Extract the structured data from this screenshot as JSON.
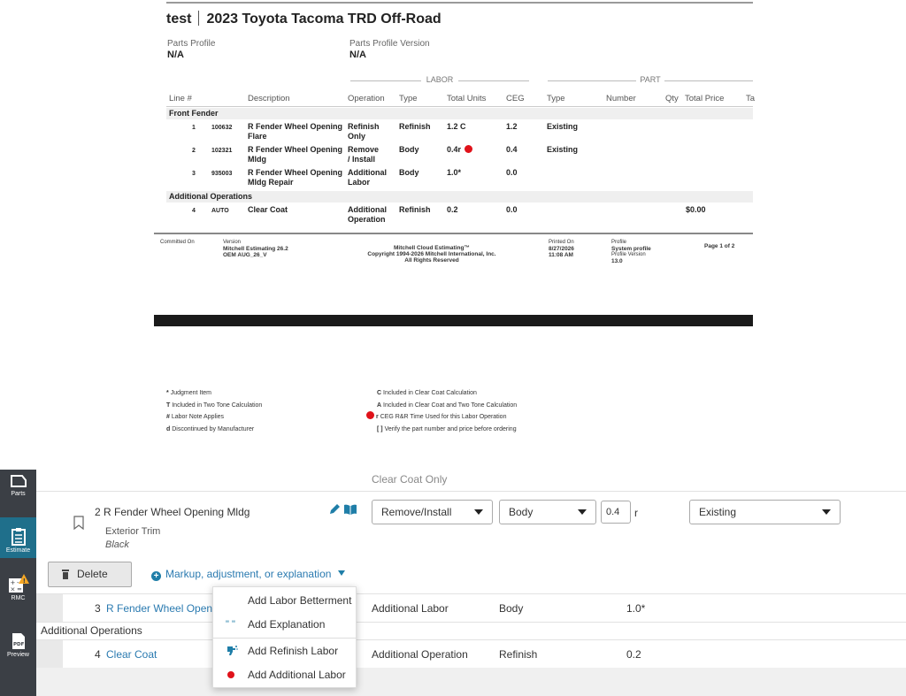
{
  "report": {
    "title_left": "test",
    "title_right": "2023 Toyota Tacoma TRD Off-Road",
    "parts_profile_label": "Parts Profile",
    "parts_profile_value": "N/A",
    "parts_profile_version_label": "Parts Profile Version",
    "parts_profile_version_value": "N/A",
    "group_labor": "LABOR",
    "group_part": "PART",
    "columns": {
      "line": "Line #",
      "description": "Description",
      "operation": "Operation",
      "type": "Type",
      "total_units": "Total Units",
      "ceg": "CEG",
      "part_type": "Type",
      "number": "Number",
      "qty": "Qty",
      "total_price": "Total Price",
      "tax": "Ta"
    },
    "section_front_fender": "Front Fender",
    "section_additional": "Additional Operations",
    "lines": [
      {
        "line": "1",
        "code": "100632",
        "desc1": "R Fender Wheel Opening",
        "desc2": "Flare",
        "op1": "Refinish",
        "op2": "Only",
        "type": "Refinish",
        "units": "1.2 C",
        "ceg": "1.2",
        "part_type": "Existing",
        "red_dot": false
      },
      {
        "line": "2",
        "code": "102321",
        "desc1": "R Fender Wheel Opening",
        "desc2": "Mldg",
        "op1": "Remove",
        "op2": "/ Install",
        "type": "Body",
        "units": "0.4r",
        "ceg": "0.4",
        "part_type": "Existing",
        "red_dot": true
      },
      {
        "line": "3",
        "code": "935003",
        "desc1": "R Fender Wheel Opening",
        "desc2": "Mldg Repair",
        "op1": "Additional",
        "op2": "Labor",
        "type": "Body",
        "units": "1.0*",
        "ceg": "0.0",
        "part_type": "",
        "red_dot": false
      }
    ],
    "additional_line": {
      "line": "4",
      "code": "AUTO",
      "desc1": "Clear Coat",
      "op1": "Additional",
      "op2": "Operation",
      "type": "Refinish",
      "units": "0.2",
      "ceg": "0.0",
      "price": "$0.00"
    },
    "footer": {
      "committed_on": "Committed On",
      "version_label": "Version",
      "version_1": "Mitchell Estimating 26.2",
      "version_2": "OEM AUG_26_V",
      "mitchell": "Mitchell Cloud Estimating™",
      "copyright": "Copyright 1994-2026 Mitchell International, Inc.",
      "rights": "All Rights Reserved",
      "printed_label": "Printed On",
      "printed_date": "8/27/2026",
      "printed_time": "11:08 AM",
      "profile_label": "Profile",
      "profile_value": "System profile",
      "profile_version_label": "Profile Version",
      "profile_version_value": "13.0",
      "page": "Page 1 of 2"
    }
  },
  "legend": {
    "left": [
      {
        "sym": "*",
        "text": "Judgment Item"
      },
      {
        "sym": "T",
        "text": "Included in Two Tone Calculation"
      },
      {
        "sym": "#",
        "text": "Labor Note Applies"
      },
      {
        "sym": "d",
        "text": "Discontinued by Manufacturer"
      }
    ],
    "right": [
      {
        "sym": "C",
        "text": "Included in Clear Coat Calculation"
      },
      {
        "sym": "A",
        "text": "Included in Clear Coat and Two Tone Calculation"
      },
      {
        "sym": "r",
        "text": "CEG R&R Time Used for this Labor Operation"
      },
      {
        "sym": "[ ]",
        "text": "Verify the part number and price before ordering"
      }
    ]
  },
  "sidebar": {
    "items": [
      {
        "label": "Parts",
        "icon": "parts-icon"
      },
      {
        "label": "Estimate",
        "icon": "estimate-icon"
      },
      {
        "label": "RMC",
        "icon": "calculator-icon"
      },
      {
        "label": "Preview",
        "icon": "pdf-icon"
      }
    ]
  },
  "editor": {
    "clear_coat_only": "Clear Coat Only",
    "item2": {
      "number": "2",
      "title": "R Fender Wheel Opening Mldg",
      "category": "Exterior Trim",
      "color": "Black",
      "operation": "Remove/Install",
      "type": "Body",
      "units": "0.4",
      "units_suffix": "r",
      "part_type": "Existing"
    },
    "delete_label": "Delete",
    "markup_label": "Markup, adjustment, or explanation",
    "row3": {
      "number": "3",
      "desc": "R Fender Wheel Openin",
      "op": "Additional Labor",
      "type": "Body",
      "units": "1.0*"
    },
    "additional_ops_label": "Additional Operations",
    "row4": {
      "number": "4",
      "desc": "Clear Coat",
      "op": "Additional Operation",
      "type": "Refinish",
      "units": "0.2"
    }
  },
  "menu": {
    "items": [
      {
        "label": "Add Labor Betterment",
        "icon": ""
      },
      {
        "label": "Add Explanation",
        "icon": "quote-icon"
      },
      {
        "label": "Add Refinish Labor",
        "icon": "spray-icon"
      },
      {
        "label": "Add Additional Labor",
        "icon": "red-dot-icon"
      }
    ]
  },
  "colors": {
    "accent": "#2a7ab0",
    "sidebar_bg": "#3b3f45",
    "sidebar_active": "#1f6f8b",
    "red_dot": "#e0121a",
    "warning": "#f5a623"
  }
}
